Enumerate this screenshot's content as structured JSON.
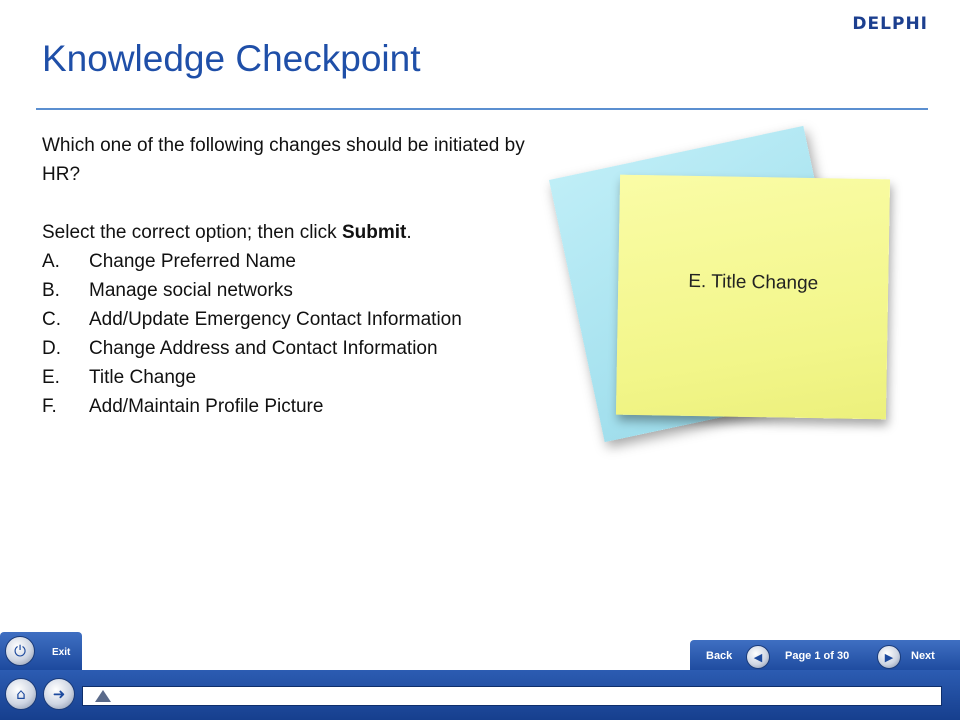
{
  "brand": {
    "logo_text": "DELPHI",
    "accent": "#1f4fa8"
  },
  "page": {
    "title": "Knowledge Checkpoint",
    "question": "Which one of the following changes should be initiated by HR?",
    "instruction_prefix": "Select the correct option; then click ",
    "instruction_bold": "Submit",
    "instruction_suffix": ".",
    "options": [
      {
        "letter": "A.",
        "text": "Change Preferred Name"
      },
      {
        "letter": "B.",
        "text": "Manage social networks"
      },
      {
        "letter": "C.",
        "text": "Add/Update Emergency Contact Information"
      },
      {
        "letter": "D.",
        "text": "Change Address and Contact Information"
      },
      {
        "letter": "E.",
        "text": "Title Change"
      },
      {
        "letter": "F.",
        "text": "Add/Maintain Profile Picture"
      }
    ],
    "sticky_note_text": "E. Title Change"
  },
  "nav": {
    "exit_label": "Exit",
    "back_label": "Back",
    "next_label": "Next",
    "page_indicator": "Page 1 of 30",
    "current_page": 1,
    "total_pages": 30,
    "icons": {
      "exit": "power-icon",
      "home": "home-icon",
      "forward": "forward-arrow-icon",
      "back": "back-arrow-icon",
      "next": "next-arrow-icon"
    }
  }
}
